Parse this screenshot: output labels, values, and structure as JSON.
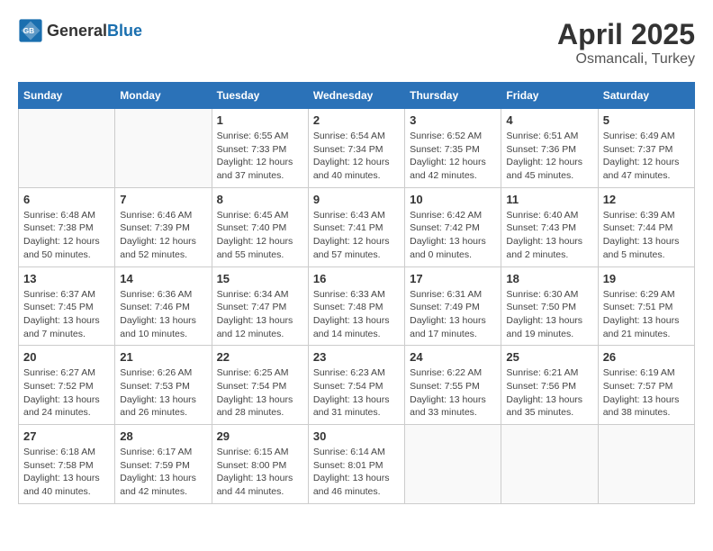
{
  "header": {
    "logo_general": "General",
    "logo_blue": "Blue",
    "title": "April 2025",
    "location": "Osmancali, Turkey"
  },
  "weekdays": [
    "Sunday",
    "Monday",
    "Tuesday",
    "Wednesday",
    "Thursday",
    "Friday",
    "Saturday"
  ],
  "weeks": [
    [
      {
        "day": "",
        "sunrise": "",
        "sunset": "",
        "daylight": ""
      },
      {
        "day": "",
        "sunrise": "",
        "sunset": "",
        "daylight": ""
      },
      {
        "day": "1",
        "sunrise": "Sunrise: 6:55 AM",
        "sunset": "Sunset: 7:33 PM",
        "daylight": "Daylight: 12 hours and 37 minutes."
      },
      {
        "day": "2",
        "sunrise": "Sunrise: 6:54 AM",
        "sunset": "Sunset: 7:34 PM",
        "daylight": "Daylight: 12 hours and 40 minutes."
      },
      {
        "day": "3",
        "sunrise": "Sunrise: 6:52 AM",
        "sunset": "Sunset: 7:35 PM",
        "daylight": "Daylight: 12 hours and 42 minutes."
      },
      {
        "day": "4",
        "sunrise": "Sunrise: 6:51 AM",
        "sunset": "Sunset: 7:36 PM",
        "daylight": "Daylight: 12 hours and 45 minutes."
      },
      {
        "day": "5",
        "sunrise": "Sunrise: 6:49 AM",
        "sunset": "Sunset: 7:37 PM",
        "daylight": "Daylight: 12 hours and 47 minutes."
      }
    ],
    [
      {
        "day": "6",
        "sunrise": "Sunrise: 6:48 AM",
        "sunset": "Sunset: 7:38 PM",
        "daylight": "Daylight: 12 hours and 50 minutes."
      },
      {
        "day": "7",
        "sunrise": "Sunrise: 6:46 AM",
        "sunset": "Sunset: 7:39 PM",
        "daylight": "Daylight: 12 hours and 52 minutes."
      },
      {
        "day": "8",
        "sunrise": "Sunrise: 6:45 AM",
        "sunset": "Sunset: 7:40 PM",
        "daylight": "Daylight: 12 hours and 55 minutes."
      },
      {
        "day": "9",
        "sunrise": "Sunrise: 6:43 AM",
        "sunset": "Sunset: 7:41 PM",
        "daylight": "Daylight: 12 hours and 57 minutes."
      },
      {
        "day": "10",
        "sunrise": "Sunrise: 6:42 AM",
        "sunset": "Sunset: 7:42 PM",
        "daylight": "Daylight: 13 hours and 0 minutes."
      },
      {
        "day": "11",
        "sunrise": "Sunrise: 6:40 AM",
        "sunset": "Sunset: 7:43 PM",
        "daylight": "Daylight: 13 hours and 2 minutes."
      },
      {
        "day": "12",
        "sunrise": "Sunrise: 6:39 AM",
        "sunset": "Sunset: 7:44 PM",
        "daylight": "Daylight: 13 hours and 5 minutes."
      }
    ],
    [
      {
        "day": "13",
        "sunrise": "Sunrise: 6:37 AM",
        "sunset": "Sunset: 7:45 PM",
        "daylight": "Daylight: 13 hours and 7 minutes."
      },
      {
        "day": "14",
        "sunrise": "Sunrise: 6:36 AM",
        "sunset": "Sunset: 7:46 PM",
        "daylight": "Daylight: 13 hours and 10 minutes."
      },
      {
        "day": "15",
        "sunrise": "Sunrise: 6:34 AM",
        "sunset": "Sunset: 7:47 PM",
        "daylight": "Daylight: 13 hours and 12 minutes."
      },
      {
        "day": "16",
        "sunrise": "Sunrise: 6:33 AM",
        "sunset": "Sunset: 7:48 PM",
        "daylight": "Daylight: 13 hours and 14 minutes."
      },
      {
        "day": "17",
        "sunrise": "Sunrise: 6:31 AM",
        "sunset": "Sunset: 7:49 PM",
        "daylight": "Daylight: 13 hours and 17 minutes."
      },
      {
        "day": "18",
        "sunrise": "Sunrise: 6:30 AM",
        "sunset": "Sunset: 7:50 PM",
        "daylight": "Daylight: 13 hours and 19 minutes."
      },
      {
        "day": "19",
        "sunrise": "Sunrise: 6:29 AM",
        "sunset": "Sunset: 7:51 PM",
        "daylight": "Daylight: 13 hours and 21 minutes."
      }
    ],
    [
      {
        "day": "20",
        "sunrise": "Sunrise: 6:27 AM",
        "sunset": "Sunset: 7:52 PM",
        "daylight": "Daylight: 13 hours and 24 minutes."
      },
      {
        "day": "21",
        "sunrise": "Sunrise: 6:26 AM",
        "sunset": "Sunset: 7:53 PM",
        "daylight": "Daylight: 13 hours and 26 minutes."
      },
      {
        "day": "22",
        "sunrise": "Sunrise: 6:25 AM",
        "sunset": "Sunset: 7:54 PM",
        "daylight": "Daylight: 13 hours and 28 minutes."
      },
      {
        "day": "23",
        "sunrise": "Sunrise: 6:23 AM",
        "sunset": "Sunset: 7:54 PM",
        "daylight": "Daylight: 13 hours and 31 minutes."
      },
      {
        "day": "24",
        "sunrise": "Sunrise: 6:22 AM",
        "sunset": "Sunset: 7:55 PM",
        "daylight": "Daylight: 13 hours and 33 minutes."
      },
      {
        "day": "25",
        "sunrise": "Sunrise: 6:21 AM",
        "sunset": "Sunset: 7:56 PM",
        "daylight": "Daylight: 13 hours and 35 minutes."
      },
      {
        "day": "26",
        "sunrise": "Sunrise: 6:19 AM",
        "sunset": "Sunset: 7:57 PM",
        "daylight": "Daylight: 13 hours and 38 minutes."
      }
    ],
    [
      {
        "day": "27",
        "sunrise": "Sunrise: 6:18 AM",
        "sunset": "Sunset: 7:58 PM",
        "daylight": "Daylight: 13 hours and 40 minutes."
      },
      {
        "day": "28",
        "sunrise": "Sunrise: 6:17 AM",
        "sunset": "Sunset: 7:59 PM",
        "daylight": "Daylight: 13 hours and 42 minutes."
      },
      {
        "day": "29",
        "sunrise": "Sunrise: 6:15 AM",
        "sunset": "Sunset: 8:00 PM",
        "daylight": "Daylight: 13 hours and 44 minutes."
      },
      {
        "day": "30",
        "sunrise": "Sunrise: 6:14 AM",
        "sunset": "Sunset: 8:01 PM",
        "daylight": "Daylight: 13 hours and 46 minutes."
      },
      {
        "day": "",
        "sunrise": "",
        "sunset": "",
        "daylight": ""
      },
      {
        "day": "",
        "sunrise": "",
        "sunset": "",
        "daylight": ""
      },
      {
        "day": "",
        "sunrise": "",
        "sunset": "",
        "daylight": ""
      }
    ]
  ]
}
